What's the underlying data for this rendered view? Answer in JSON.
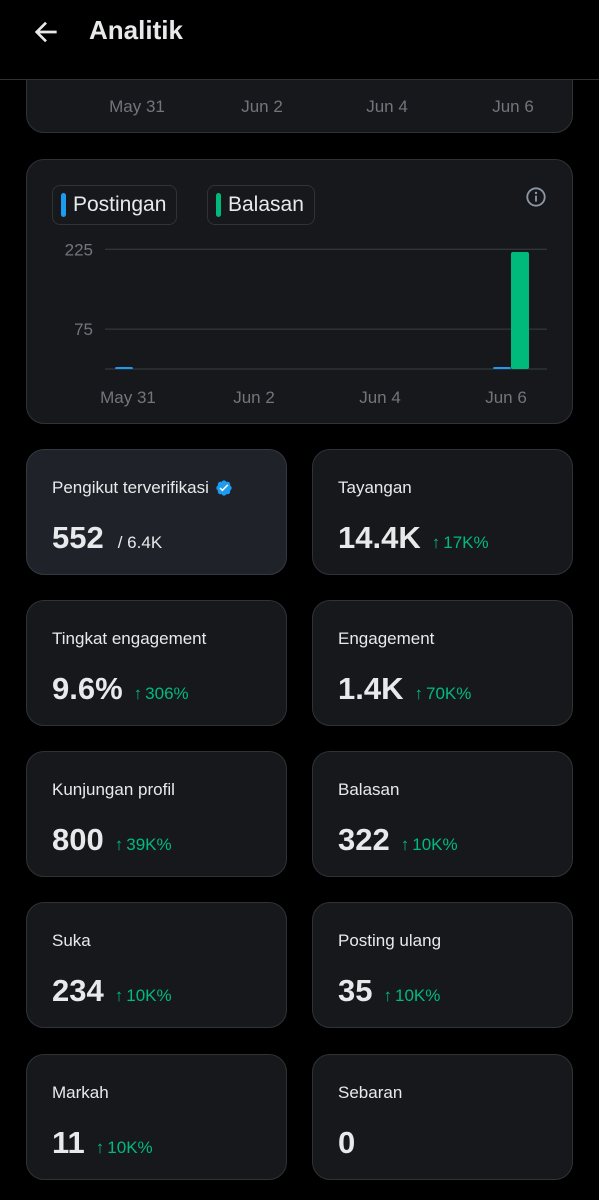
{
  "header": {
    "title": "Analitik",
    "back_icon": "arrow-left-icon"
  },
  "top_chart": {
    "x_ticks": [
      "May 31",
      "Jun 2",
      "Jun 4",
      "Jun 6"
    ]
  },
  "chart_data": {
    "type": "bar",
    "legend": [
      {
        "name": "Postingan",
        "color": "#1d9bf0"
      },
      {
        "name": "Balasan",
        "color": "#00ba7c"
      }
    ],
    "y_ticks": [
      225,
      75
    ],
    "x_ticks": [
      "May 31",
      "Jun 2",
      "Jun 4",
      "Jun 6"
    ],
    "categories": [
      "May 31",
      "Jun 1",
      "Jun 2",
      "Jun 3",
      "Jun 4",
      "Jun 5",
      "Jun 6"
    ],
    "series": [
      {
        "name": "Postingan",
        "values": [
          1,
          0,
          0,
          0,
          0,
          0,
          1
        ]
      },
      {
        "name": "Balasan",
        "values": [
          0,
          0,
          0,
          0,
          0,
          0,
          220
        ]
      }
    ],
    "ylim": [
      0,
      250
    ],
    "grid": true,
    "legend_position": "top-left"
  },
  "metrics": [
    {
      "label": "Pengikut terverifikasi",
      "value": "552",
      "total": "/ 6.4K",
      "delta": "",
      "verified": true
    },
    {
      "label": "Tayangan",
      "value": "14.4K",
      "total": "",
      "delta": "17K%"
    },
    {
      "label": "Tingkat engagement",
      "value": "9.6%",
      "total": "",
      "delta": "306%"
    },
    {
      "label": "Engagement",
      "value": "1.4K",
      "total": "",
      "delta": "70K%"
    },
    {
      "label": "Kunjungan profil",
      "value": "800",
      "total": "",
      "delta": "39K%"
    },
    {
      "label": "Balasan",
      "value": "322",
      "total": "",
      "delta": "10K%"
    },
    {
      "label": "Suka",
      "value": "234",
      "total": "",
      "delta": "10K%"
    },
    {
      "label": "Posting ulang",
      "value": "35",
      "total": "",
      "delta": "10K%"
    },
    {
      "label": "Markah",
      "value": "11",
      "total": "",
      "delta": "10K%"
    },
    {
      "label": "Sebaran",
      "value": "0",
      "total": "",
      "delta": ""
    }
  ],
  "delta_arrow": "↑",
  "colors": {
    "accent": "#1d9bf0",
    "positive": "#00ba7c",
    "card_bg": "#16181c",
    "border": "#2f3336"
  }
}
